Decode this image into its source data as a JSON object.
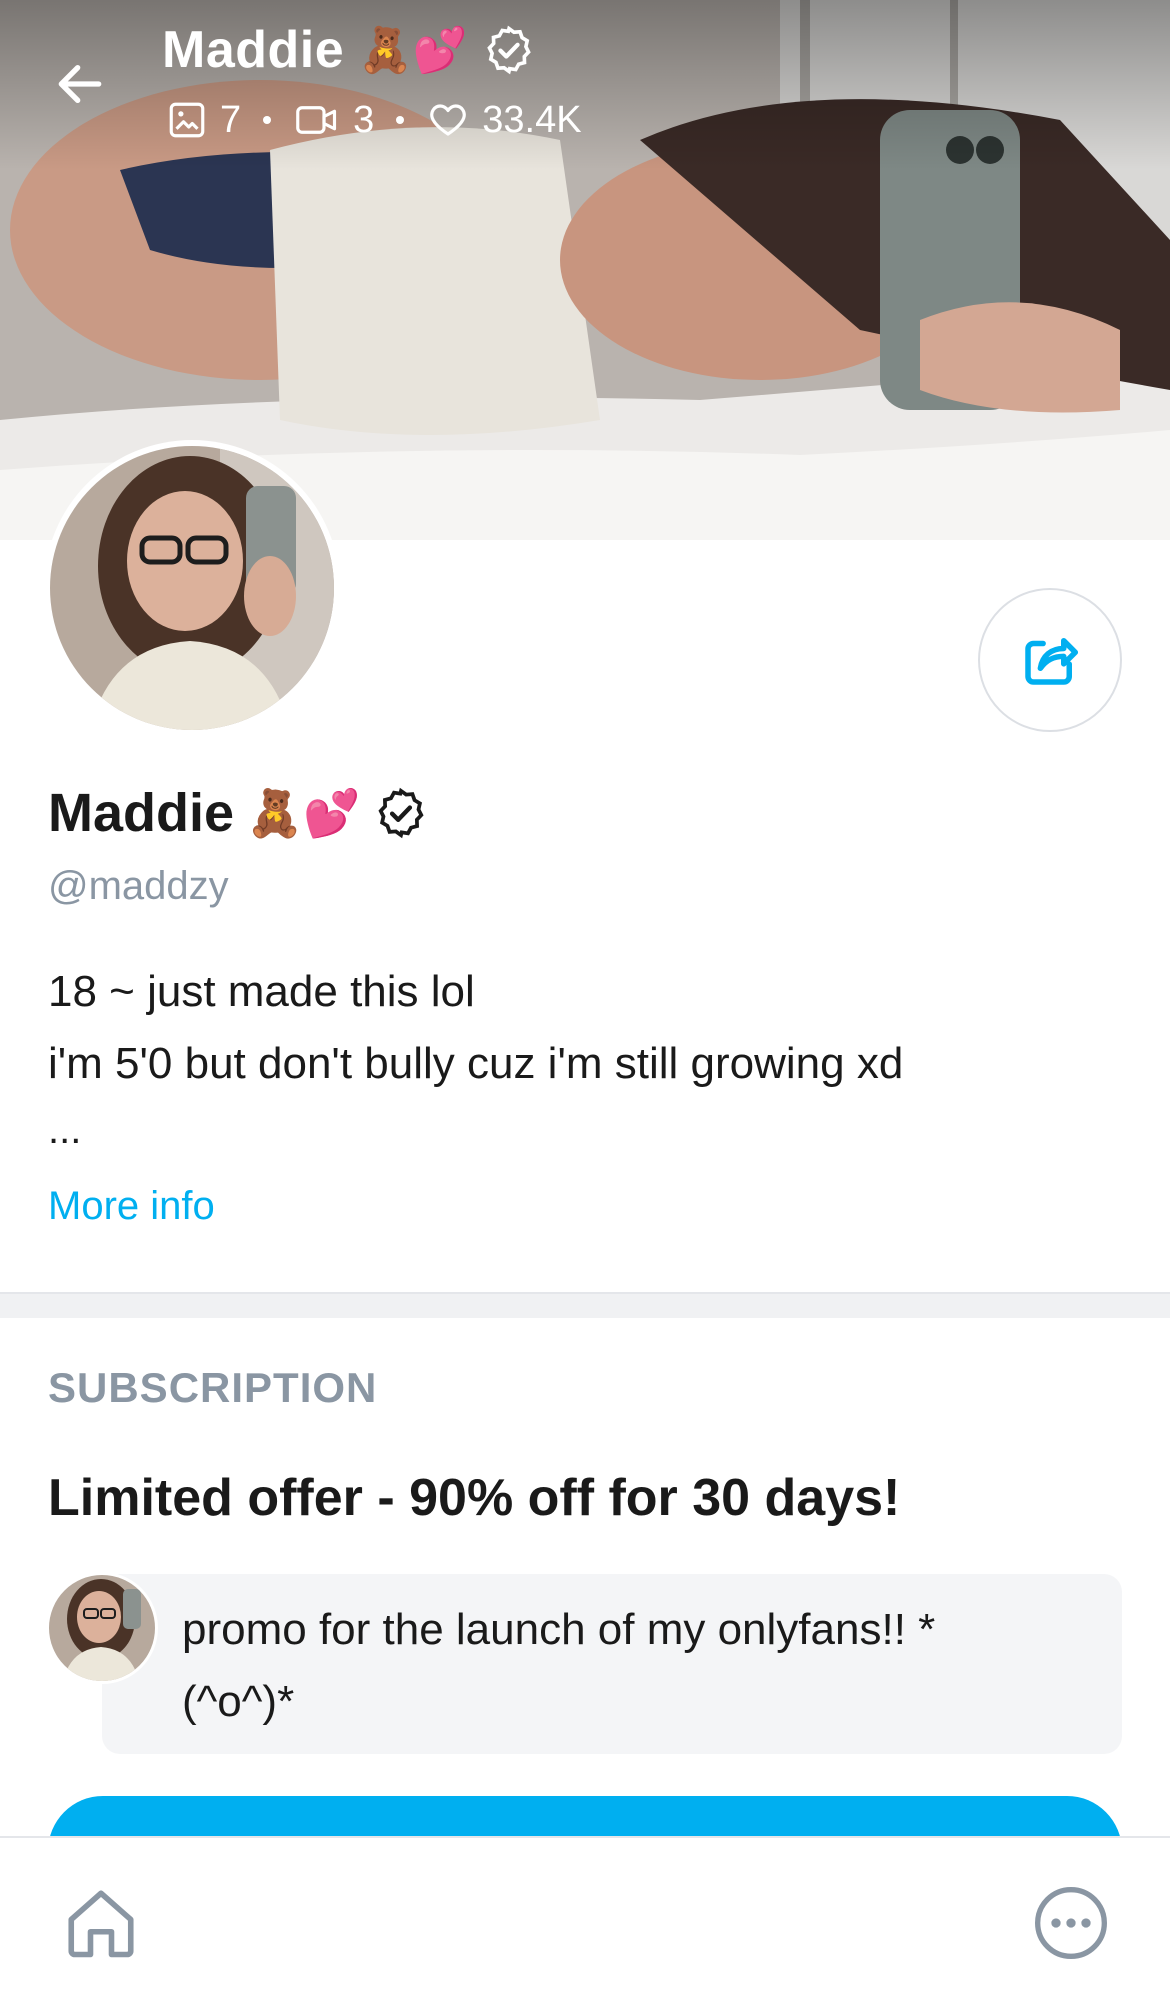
{
  "header": {
    "back_icon": "arrow-left-icon",
    "name": "Maddie",
    "name_emojis": "🧸💕",
    "verified_icon": "verified-badge-icon",
    "stats": {
      "photos": "7",
      "videos": "3",
      "likes": "33.4K"
    }
  },
  "profile": {
    "name": "Maddie",
    "name_emojis": "🧸💕",
    "handle": "@maddzy",
    "bio_line1": "18 ~ just made this lol",
    "bio_line2": "i'm 5'0 but don't bully cuz i'm still growing xd",
    "bio_ellipsis": "...",
    "more_info": "More info",
    "share_icon": "share-icon"
  },
  "subscription": {
    "title": "SUBSCRIPTION",
    "offer": "Limited offer - 90% off for 30 days!",
    "promo_line1": "promo for the launch of my onlyfans!! *",
    "promo_line2": "(^o^)*"
  },
  "bottom_nav": {
    "home_icon": "home-icon",
    "more_icon": "more-options-icon"
  },
  "colors": {
    "accent": "#00aff0",
    "muted": "#8a96a3",
    "text": "#1a1a1a"
  }
}
